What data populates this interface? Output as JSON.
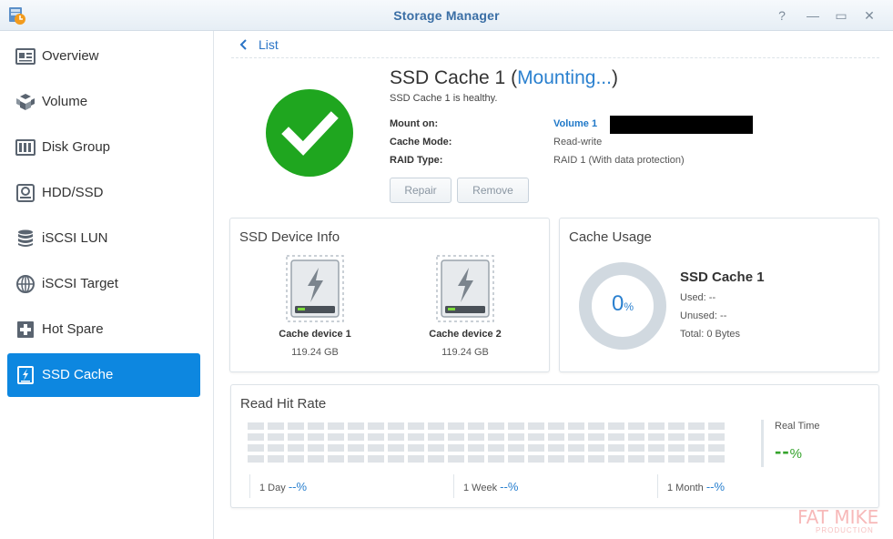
{
  "window": {
    "title": "Storage Manager",
    "help_icon": "?",
    "minimize_icon": "—",
    "maximize_icon": "▭",
    "close_icon": "✕"
  },
  "sidebar": {
    "items": [
      {
        "label": "Overview",
        "icon": "overview-icon"
      },
      {
        "label": "Volume",
        "icon": "volume-icon"
      },
      {
        "label": "Disk Group",
        "icon": "disk-group-icon"
      },
      {
        "label": "HDD/SSD",
        "icon": "hdd-icon"
      },
      {
        "label": "iSCSI LUN",
        "icon": "iscsi-lun-icon"
      },
      {
        "label": "iSCSI Target",
        "icon": "iscsi-target-icon"
      },
      {
        "label": "Hot Spare",
        "icon": "hot-spare-icon"
      },
      {
        "label": "SSD Cache",
        "icon": "ssd-cache-icon",
        "active": true
      }
    ],
    "active_color": "#0d87e0"
  },
  "main": {
    "back_label": "List",
    "cache": {
      "name": "SSD Cache 1",
      "paren_open": " (",
      "mount_status": "Mounting...",
      "paren_close": ")",
      "health": "SSD Cache 1 is healthy.",
      "fields": [
        {
          "label": "Mount on:",
          "value": "Volume 1"
        },
        {
          "label": "Cache Mode:",
          "value": "Read-write"
        },
        {
          "label": "RAID Type:",
          "value": "RAID 1 (With data protection)"
        }
      ],
      "status_color": "#1fa61f"
    },
    "buttons": {
      "repair": "Repair",
      "remove": "Remove"
    },
    "device_info": {
      "title": "SSD Device Info",
      "devices": [
        {
          "name": "Cache device 1",
          "size": "119.24 GB"
        },
        {
          "name": "Cache device 2",
          "size": "119.24 GB"
        }
      ]
    },
    "cache_usage": {
      "title": "Cache Usage",
      "percent_value": "0",
      "percent_sign": "%",
      "name": "SSD Cache 1",
      "used": "Used: --",
      "unused": "Unused: --",
      "total": "Total: 0 Bytes"
    },
    "read_hit_rate": {
      "title": "Read Hit Rate",
      "real_time_label": "Real Time",
      "real_time_value": "--",
      "percent_sign": "%",
      "periods": [
        {
          "label": "1 Day",
          "value": "--",
          "unit": "%"
        },
        {
          "label": "1 Week",
          "value": "--",
          "unit": "%"
        },
        {
          "label": "1 Month",
          "value": "--",
          "unit": "%"
        }
      ]
    }
  },
  "watermark": {
    "line1": "FAT MIKE",
    "line2": "PRODUCTION"
  }
}
